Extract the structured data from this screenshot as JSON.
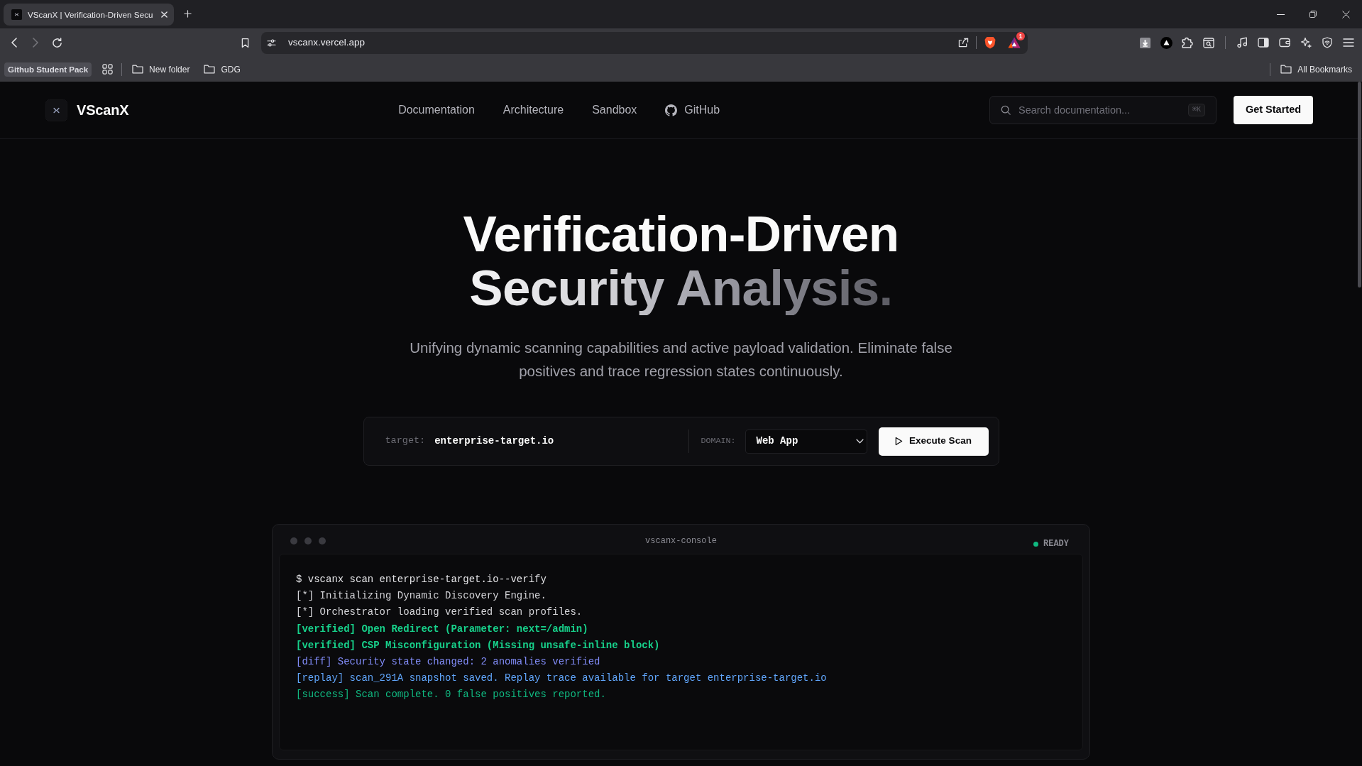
{
  "browser": {
    "tabs": [
      {
        "title": "VScanX | Verification-Driven Secu",
        "selected": true
      }
    ],
    "nav_buttons": [
      {
        "kind": "back",
        "disabled": false
      },
      {
        "kind": "forward",
        "disabled": true
      },
      {
        "kind": "reload",
        "disabled": false
      }
    ],
    "address": "vscanx.vercel.app",
    "notification_count": "1",
    "bookmarks": [
      {
        "kind": "pill",
        "label": "Github Student Pack"
      },
      {
        "kind": "apps"
      },
      {
        "kind": "folder",
        "label": "New folder"
      },
      {
        "kind": "folder",
        "label": "GDG"
      }
    ],
    "bookmarks_right": [
      {
        "kind": "folder",
        "label": "All Bookmarks"
      }
    ]
  },
  "site_nav": {
    "brand": "VScanX",
    "links": [
      {
        "kind": "link",
        "label": "Documentation"
      },
      {
        "kind": "link",
        "label": "Architecture"
      },
      {
        "kind": "link",
        "label": "Sandbox"
      },
      {
        "kind": "github",
        "label": "GitHub"
      }
    ],
    "search": {
      "placeholder": "Search documentation...",
      "shortcut": "⌘K"
    },
    "cta": "Get Started"
  },
  "hero": {
    "title_lines": [
      "Verification-Driven",
      "Security Analysis."
    ],
    "subtitle": "Unifying dynamic scanning capabilities and active payload validation. Eliminate false positives and trace regression states continuously."
  },
  "scan_form": {
    "target_label": "target:",
    "target": "enterprise-target.io",
    "domain_label": "DOMAIN:",
    "domain": "Web App",
    "button": "Execute Scan"
  },
  "console": {
    "title": "vscanx-console",
    "status": "READY",
    "lines": [
      {
        "kind": "command",
        "text": "$ vscanx scan enterprise-target.io--verify"
      },
      {
        "kind": "info",
        "text": "[*] Initializing Dynamic Discovery Engine."
      },
      {
        "kind": "info",
        "text": "[*] Orchestrator loading verified scan profiles."
      },
      {
        "kind": "verified",
        "text": "[verified] Open Redirect (Parameter: next=/admin)"
      },
      {
        "kind": "verified",
        "text": "[verified] CSP Misconfiguration (Missing unsafe-inline block)"
      },
      {
        "kind": "diff",
        "text": "[diff] Security state changed: 2 anomalies verified"
      },
      {
        "kind": "replay",
        "text": "[replay] scan_291A snapshot saved. Replay trace available for target enterprise-target.io"
      },
      {
        "kind": "success",
        "text": "[success] Scan complete. 0 false positives reported."
      }
    ]
  }
}
